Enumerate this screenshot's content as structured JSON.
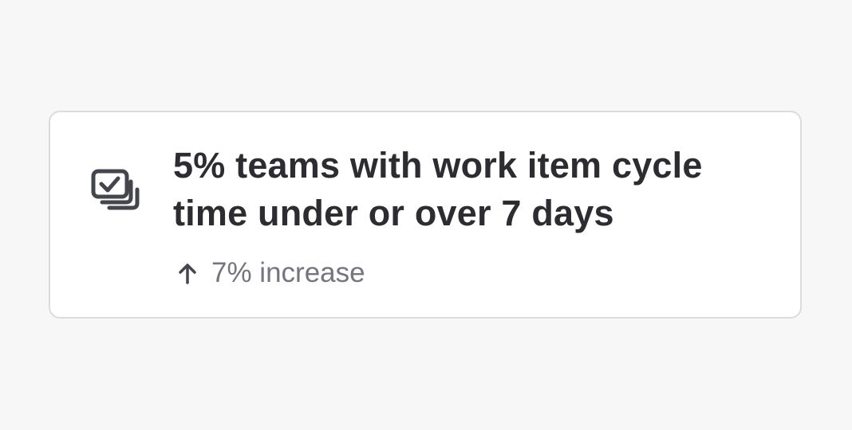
{
  "card": {
    "icon": "stacked-checkbox-icon",
    "title": "5% teams with work item cycle time under or over 7 days",
    "trend": {
      "direction_icon": "arrow-up-icon",
      "text": "7% increase"
    }
  },
  "colors": {
    "background": "#f7f7f7",
    "card_background": "#ffffff",
    "card_border": "#dcdcde",
    "title_text": "#2c2c31",
    "secondary_text": "#74757d",
    "icon": "#45464d"
  }
}
